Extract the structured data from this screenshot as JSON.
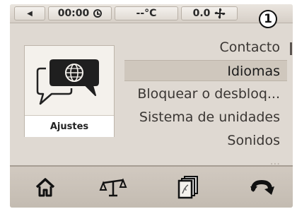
{
  "status_bar": {
    "back_icon": "back-arrow-icon",
    "time": "00:00",
    "time_icon": "clock-icon",
    "temperature": "--°C",
    "fan_speed": "0.0",
    "fan_icon": "fan-icon"
  },
  "callout_number": "1",
  "tile": {
    "icon": "language-speech-bubble-icon",
    "label": "Ajustes"
  },
  "menu": {
    "items": [
      {
        "label": "Contacto",
        "selected": false
      },
      {
        "label": "Idiomas",
        "selected": true
      },
      {
        "label": "Bloquear o desbloq...",
        "selected": false
      },
      {
        "label": "Sistema de unidades",
        "selected": false
      },
      {
        "label": "Sonidos",
        "selected": false
      }
    ],
    "partial_next": "..."
  },
  "bottom_nav": [
    {
      "icon": "home-icon"
    },
    {
      "icon": "scale-icon"
    },
    {
      "icon": "cards-icon"
    },
    {
      "icon": "rotate-icon"
    }
  ],
  "colors": {
    "screen_bg": "#dfd9d2",
    "selected_bg": "#cfc7bd",
    "bottom_bar": "#c8c0b6"
  }
}
